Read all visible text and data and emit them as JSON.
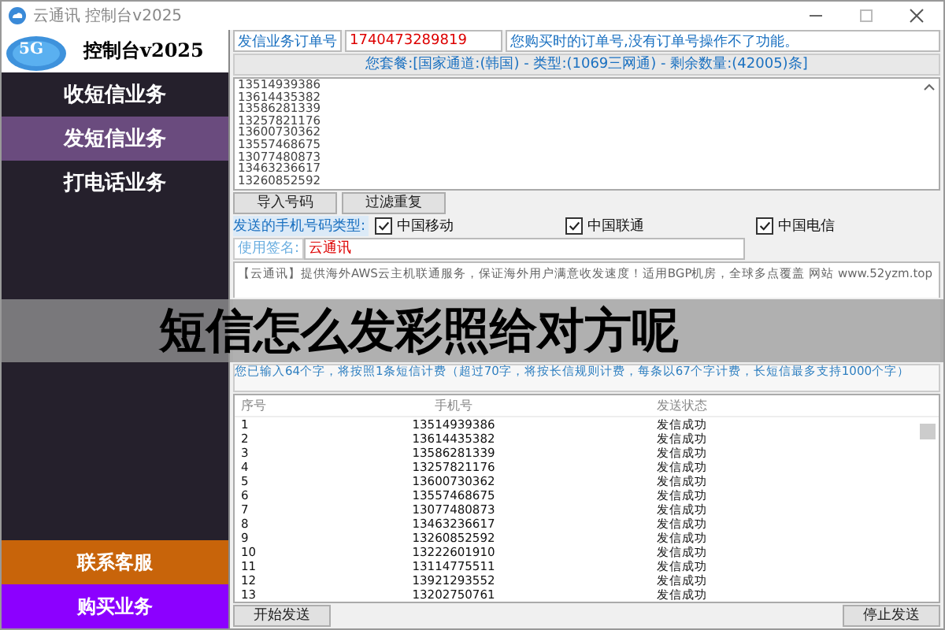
{
  "window": {
    "title": "云通讯 控制台v2025"
  },
  "logo": {
    "badge": "5G",
    "title": "控制台v2025"
  },
  "sidebar": {
    "items": [
      {
        "label": "收短信业务",
        "selected": false
      },
      {
        "label": "发短信业务",
        "selected": true
      },
      {
        "label": "打电话业务",
        "selected": false
      }
    ],
    "bottom_buttons": [
      {
        "label": "联系客服",
        "color": "#c8640a"
      },
      {
        "label": "购买业务",
        "color": "#8c00ff"
      }
    ]
  },
  "order": {
    "label": "发信业务订单号",
    "value": "1740473289819",
    "notice": "您购买时的订单号,没有订单号操作不了功能。"
  },
  "package_info": "您套餐:[国家通道:(韩国) - 类型:(1069三网通) - 剩余数量:(42005)条]",
  "numbers_text": [
    "13514939386",
    "13614435382",
    "13586281339",
    "13257821176",
    "13600730362",
    "13557468675",
    "13077480873",
    "13463236617",
    "13260852592"
  ],
  "number_buttons": [
    "导入号码",
    "过滤重复"
  ],
  "carrier_type": {
    "label": "发送的手机号码类型:",
    "options": [
      {
        "label": "中国移动",
        "checked": true
      },
      {
        "label": "中国联通",
        "checked": true
      },
      {
        "label": "中国电信",
        "checked": true
      }
    ]
  },
  "signature": {
    "label": "使用签名:",
    "value": "云通讯"
  },
  "message": "【云通讯】提供海外AWS云主机联通服务，保证海外用户满意收发速度！适用BGP机房，全球多点覆盖 网站 www.52yzm.top",
  "counter": "您已输入64个字，将按照1条短信计费（超过70字，将按长信规则计费，每条以67个字计费，长短信最多支持1000个字）",
  "table": {
    "columns": [
      "序号",
      "手机号",
      "发送状态"
    ],
    "rows": [
      [
        "1",
        "13514939386",
        "发信成功"
      ],
      [
        "2",
        "13614435382",
        "发信成功"
      ],
      [
        "3",
        "13586281339",
        "发信成功"
      ],
      [
        "4",
        "13257821176",
        "发信成功"
      ],
      [
        "5",
        "13600730362",
        "发信成功"
      ],
      [
        "6",
        "13557468675",
        "发信成功"
      ],
      [
        "7",
        "13077480873",
        "发信成功"
      ],
      [
        "8",
        "13463236617",
        "发信成功"
      ],
      [
        "9",
        "13260852592",
        "发信成功"
      ],
      [
        "10",
        "13222601910",
        "发信成功"
      ],
      [
        "11",
        "13114775511",
        "发信成功"
      ],
      [
        "12",
        "13921293552",
        "发信成功"
      ],
      [
        "13",
        "13202750761",
        "发信成功"
      ]
    ]
  },
  "actions": [
    "开始发送",
    "停止发送"
  ],
  "overlay_title": "短信怎么发彩照给对方呢"
}
